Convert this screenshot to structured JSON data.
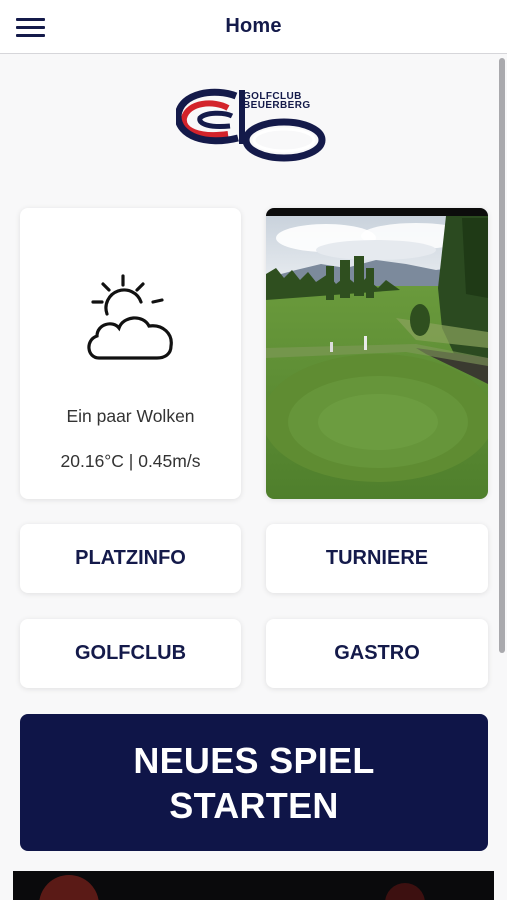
{
  "header": {
    "title": "Home"
  },
  "logo": {
    "line1": "GOLFCLUB",
    "line2": "BEUERBERG",
    "brand_blue": "#141a4a",
    "brand_red": "#d3232b"
  },
  "weather": {
    "icon": "partly-cloudy-icon",
    "description": "Ein paar Wolken",
    "stats": "20.16°C | 0.45m/s"
  },
  "webcam": {
    "label": "golf-course-webcam"
  },
  "nav": {
    "platzinfo": "PLATZINFO",
    "turniere": "TURNIERE",
    "golfclub": "GOLFCLUB",
    "gastro": "GASTRO"
  },
  "cta": {
    "label": "NEUES SPIEL STARTEN",
    "color": "#0f1548"
  },
  "colors": {
    "accent": "#141a4a",
    "background": "#f8f8f9"
  }
}
